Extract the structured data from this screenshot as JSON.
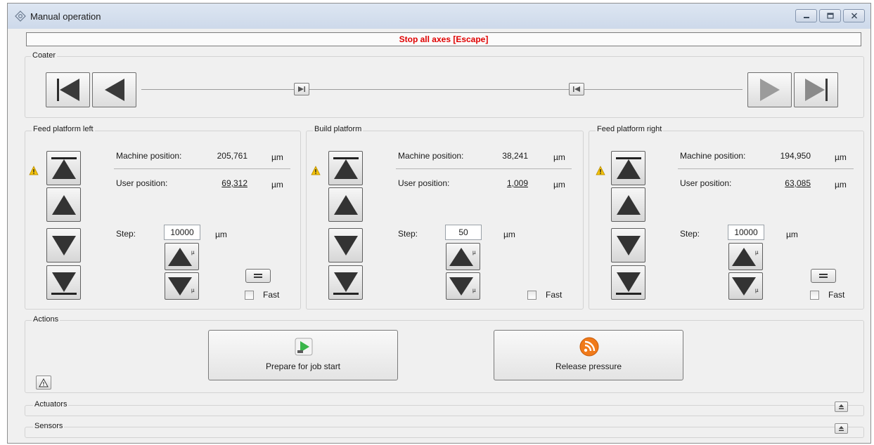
{
  "window": {
    "title": "Manual operation",
    "icons": {
      "app": "gear-diamond-icon",
      "minimize": "minimize-icon",
      "maximize": "maximize-icon",
      "close": "close-icon"
    }
  },
  "stop_bar": {
    "label": "Stop all axes  [Escape]",
    "color": "#e00000"
  },
  "coater": {
    "title": "Coater"
  },
  "platforms": {
    "left": {
      "title": "Feed platform left",
      "machine_label": "Machine position:",
      "machine_value": "205,761",
      "machine_unit": "µm",
      "user_label": "User position:",
      "user_value": "69,312",
      "user_unit": "µm",
      "step_label": "Step:",
      "step_value": "10000",
      "step_unit": "µm",
      "fast_label": "Fast"
    },
    "build": {
      "title": "Build platform",
      "machine_label": "Machine position:",
      "machine_value": "38,241",
      "machine_unit": "µm",
      "user_label": "User position:",
      "user_value": "1,009",
      "user_unit": "µm",
      "step_label": "Step:",
      "step_value": "50",
      "step_unit": "µm",
      "fast_label": "Fast"
    },
    "right": {
      "title": "Feed platform right",
      "machine_label": "Machine position:",
      "machine_value": "194,950",
      "machine_unit": "µm",
      "user_label": "User position:",
      "user_value": "63,085",
      "user_unit": "µm",
      "step_label": "Step:",
      "step_value": "10000",
      "step_unit": "µm",
      "fast_label": "Fast"
    }
  },
  "actions": {
    "title": "Actions",
    "prepare_label": "Prepare for job start",
    "release_label": "Release pressure"
  },
  "actuators": {
    "title": "Actuators"
  },
  "sensors": {
    "title": "Sensors"
  },
  "micro_symbol": "µ"
}
